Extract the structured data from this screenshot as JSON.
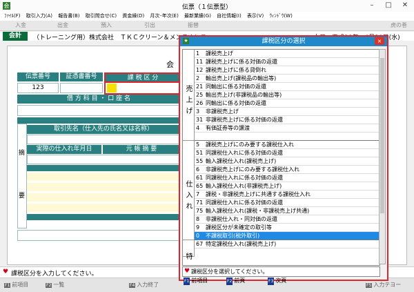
{
  "window": {
    "title": "伝票（１伝票型）",
    "app_icon": "会"
  },
  "menu": [
    "ﾌｧｲﾙ(F)",
    "取引入力(A)",
    "報告書(B)",
    "取引問合せ(C)",
    "資金繰(D)",
    "月次･年次(E)",
    "最新業績(G)",
    "自社情報(I)",
    "表示(V)",
    "ｳｨﾝﾄﾞｳ(W)"
  ],
  "toolbar": [
    "入金",
    "出金",
    "預入",
    "引出",
    "振替",
    "虎の巻"
  ],
  "header": {
    "kaikei": "会計",
    "company": "（トレーニング用）株式会社　ＴＫＣクリーン＆メンテナンス",
    "date": "本日　平成28年　4月30日(水)"
  },
  "form": {
    "top_label": "会",
    "col_denpyo": "伝票番号",
    "col_shoko": "証憑書番号",
    "col_kazei": "課 税 区 分",
    "denpyo_no": "123",
    "kamoku": "借 方 科 目 ・ 口 座 名",
    "torihiki": "取引先名（仕入先の氏名又は名称）",
    "shiire_date": "実際の仕入れ年月日",
    "moto_tekiyo": "元 帳 摘 要",
    "tekiyo_1": "摘",
    "tekiyo_2": "要"
  },
  "dialog": {
    "title": "課税区分の選択",
    "close": "×",
    "groups": [
      {
        "label": "売上げ",
        "rows": 11
      },
      {
        "label": "仕入れ",
        "rows": 12
      },
      {
        "label": "特",
        "rows": 2
      }
    ],
    "items": [
      {
        "code": "1",
        "text": "課税売上げ"
      },
      {
        "code": "11",
        "text": "課税売上げに係る対価の返還"
      },
      {
        "code": "12",
        "text": "課税売上げに係る貸倒れ"
      },
      {
        "code": "2",
        "text": "輸出売上げ(課税品の輸出等)"
      },
      {
        "code": "21",
        "text": "同輸出に係る対価の返還"
      },
      {
        "code": "25",
        "text": "輸出売上げ(非課税品の輸出等)"
      },
      {
        "code": "26",
        "text": "同輸出に係る対価の返還"
      },
      {
        "code": "3",
        "text": "非課税売上げ"
      },
      {
        "code": "31",
        "text": "非課税売上げに係る対価の返還"
      },
      {
        "code": "4",
        "text": "有価証券等の譲渡"
      },
      {
        "code": "",
        "text": ""
      },
      {
        "code": "5",
        "text": "課税売上げにのみ要する課税仕入れ"
      },
      {
        "code": "51",
        "text": "同課税仕入れに係る対価の返還"
      },
      {
        "code": "55",
        "text": "輸入課税仕入れ(課税売上げ)"
      },
      {
        "code": "6",
        "text": "非課税売上げにのみ要する課税仕入れ"
      },
      {
        "code": "61",
        "text": "同課税仕入れに係る対価の返還"
      },
      {
        "code": "65",
        "text": "輸入課税仕入れ(非課税売上げ)"
      },
      {
        "code": "7",
        "text": "課税・非課税売上げに共通する課税仕入れ"
      },
      {
        "code": "71",
        "text": "同課税仕入れに係る対価の返還"
      },
      {
        "code": "75",
        "text": "輸入課税仕入れ(課税・非課税売上げ共通)"
      },
      {
        "code": "8",
        "text": "非課税仕入れ・同対価の返還"
      },
      {
        "code": "9",
        "text": "課税区分が未確定の取引等"
      },
      {
        "code": "0",
        "text": "不課税取引(税外取引)"
      },
      {
        "code": "67",
        "text": "特定課税仕入れ(課税売上げ)"
      }
    ],
    "selected_code": "0",
    "prompt": "課税区分を選択してください。",
    "fkeys": [
      {
        "key": "F1",
        "label": "前項目"
      },
      {
        "key": "F2",
        "label": "前頁"
      },
      {
        "key": "F3",
        "label": "次頁"
      }
    ]
  },
  "status": {
    "message": "課税区分を入力してください。"
  },
  "fkeys": [
    {
      "key": "F1",
      "label": "前項目"
    },
    {
      "key": "F2",
      "label": "一覧"
    },
    {
      "key": "F4",
      "label": "入力終了"
    },
    {
      "key": "F5",
      "label": "入力テヨー"
    }
  ]
}
